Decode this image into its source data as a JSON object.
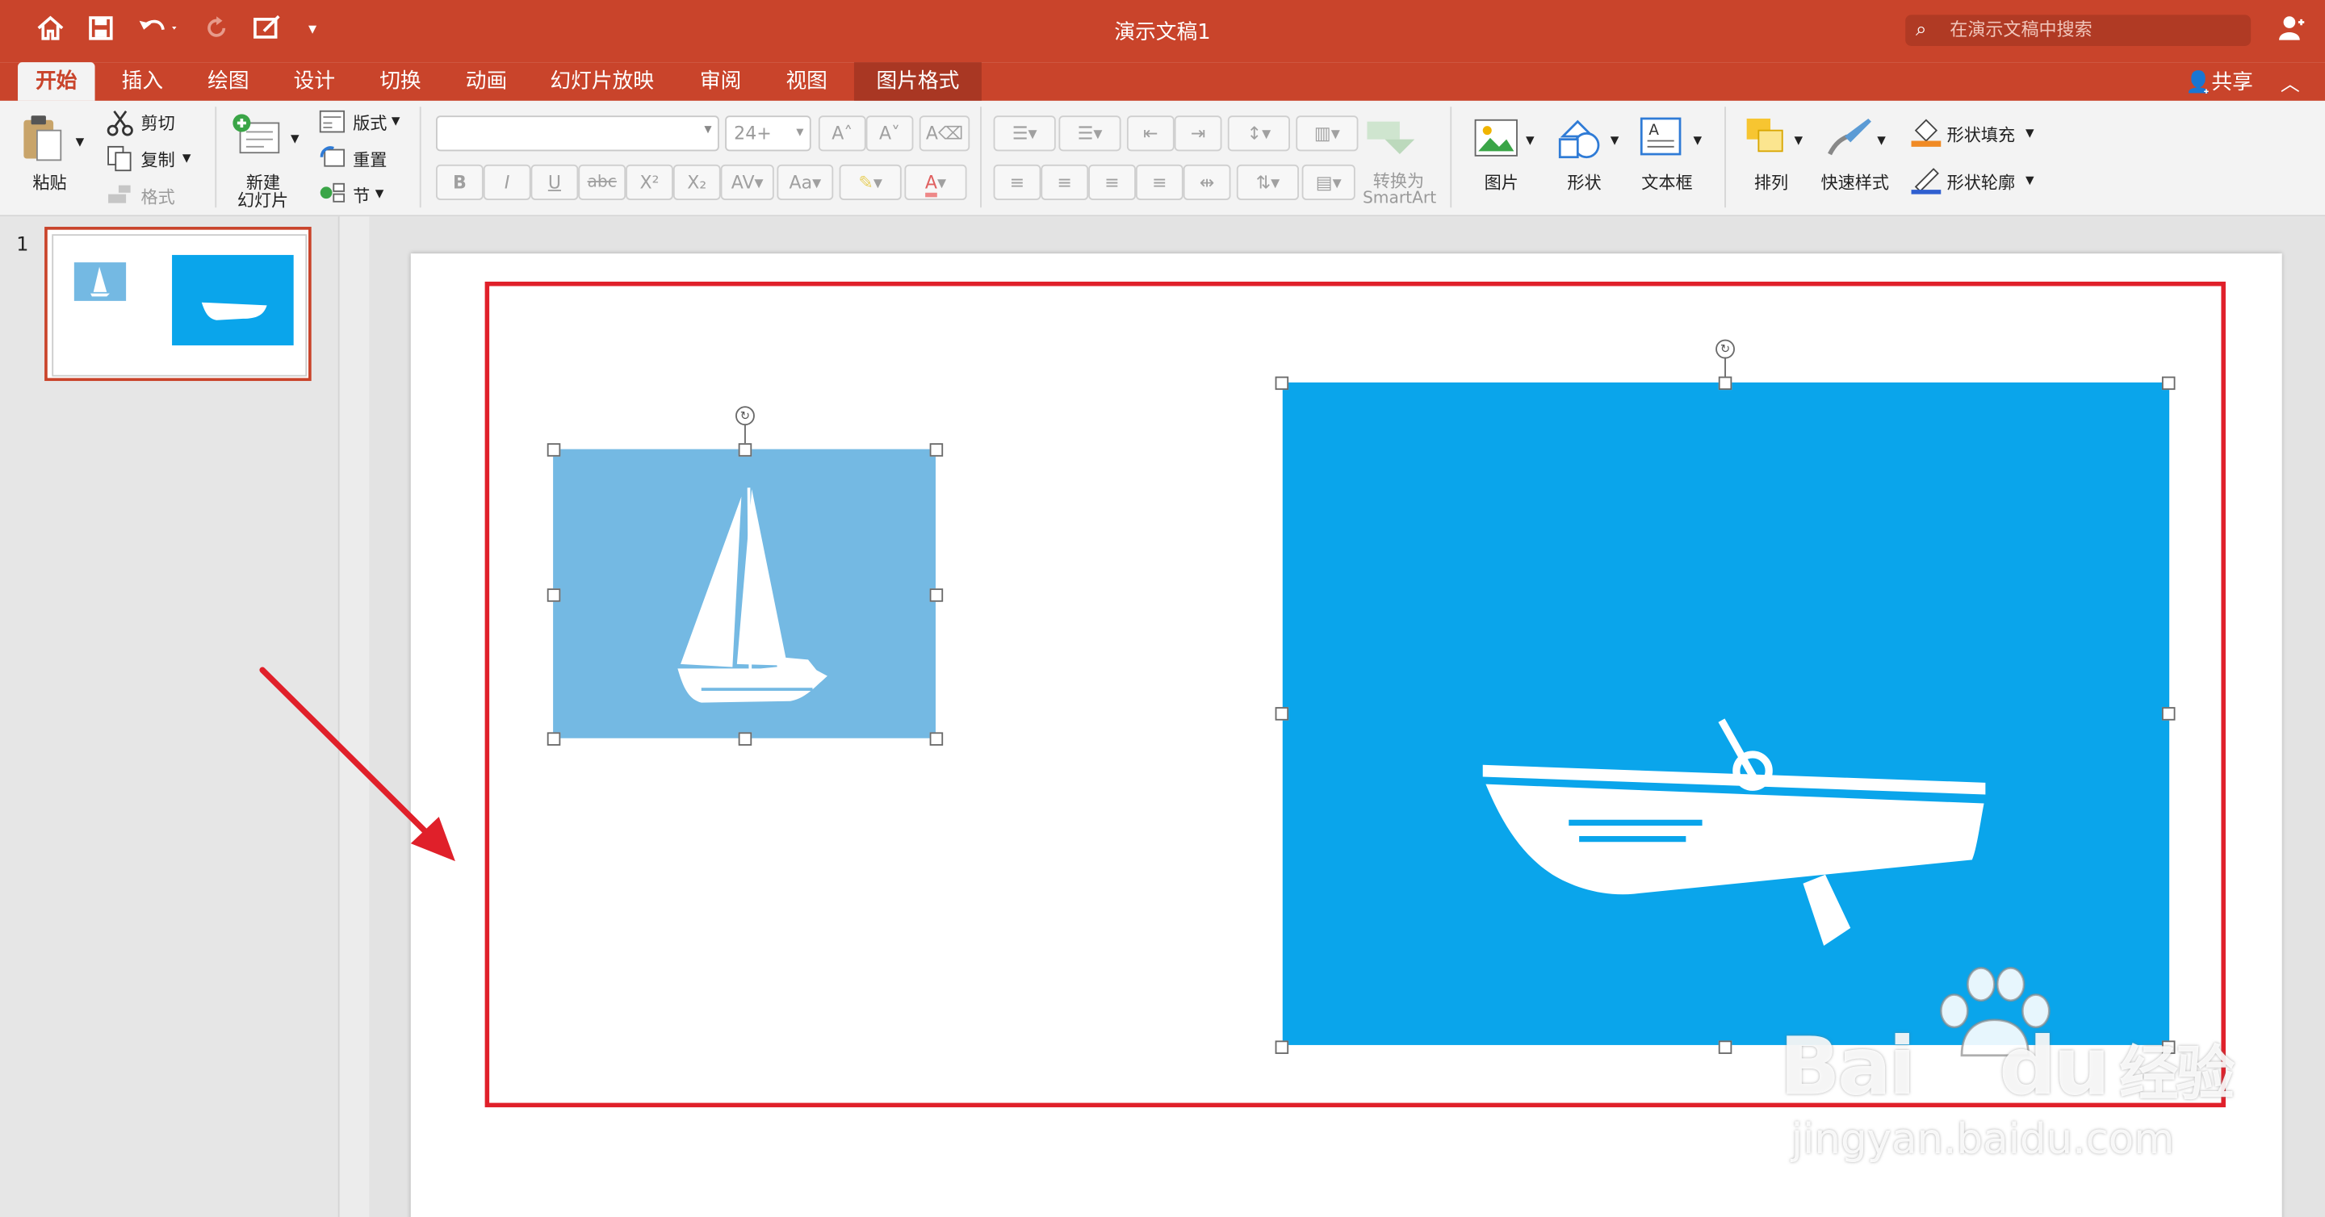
{
  "window": {
    "title": "演示文稿1"
  },
  "search": {
    "placeholder": "在演示文稿中搜索"
  },
  "tabs": [
    {
      "label": "开始",
      "active": true
    },
    {
      "label": "插入"
    },
    {
      "label": "绘图"
    },
    {
      "label": "设计"
    },
    {
      "label": "切换"
    },
    {
      "label": "动画"
    },
    {
      "label": "幻灯片放映"
    },
    {
      "label": "审阅"
    },
    {
      "label": "视图"
    },
    {
      "label": "图片格式",
      "contextual": true
    }
  ],
  "share_label": "共享",
  "ribbon": {
    "paste": "粘贴",
    "cut": "剪切",
    "copy": "复制",
    "format_painter": "格式",
    "new_slide": [
      "新建",
      "幻灯片"
    ],
    "layout": "版式",
    "reset": "重置",
    "section": "节",
    "font_size": "24+",
    "convert_smartart": [
      "转换为",
      "SmartArt"
    ],
    "picture": "图片",
    "shape": "形状",
    "textbox": "文本框",
    "arrange": "排列",
    "quick_styles": "快速样式",
    "shape_fill": "形状填充",
    "shape_outline": "形状轮廓"
  },
  "thumbnails": [
    {
      "number": "1"
    }
  ],
  "slide": {
    "images": [
      {
        "name": "sailboat",
        "fill": "#74b9e3"
      },
      {
        "name": "rowboat",
        "fill": "#0aa5eb"
      }
    ],
    "highlight_color": "#e0202a",
    "arrow_color": "#e0202a"
  },
  "watermark": {
    "brand": "Bai",
    "brand2": "du",
    "cn": "经验",
    "url": "jingyan.baidu.com"
  },
  "colors": {
    "accent": "#c9442b",
    "ribbon_bg": "#f3f3f3"
  }
}
